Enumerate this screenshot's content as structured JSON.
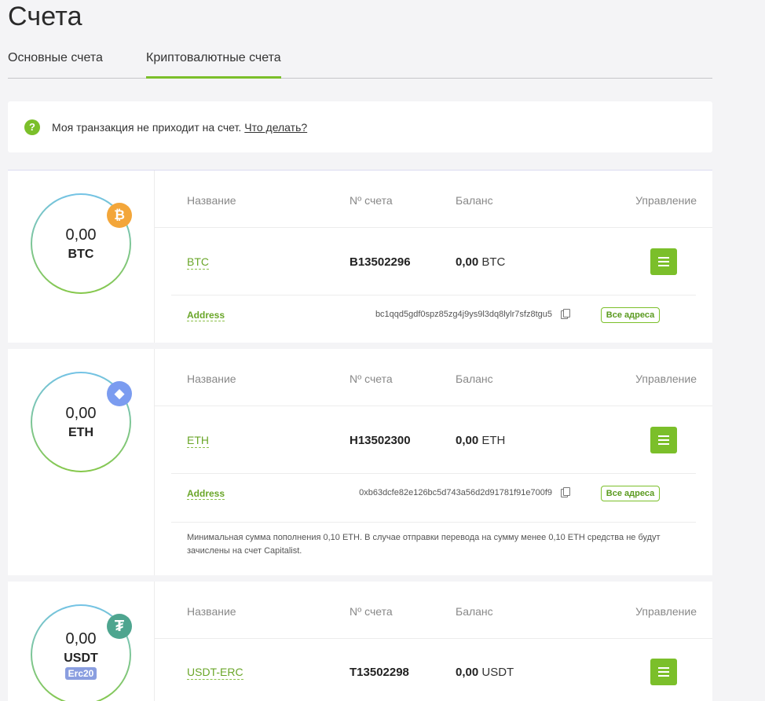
{
  "page": {
    "title": "Счета",
    "tabs": [
      {
        "label": "Основные счета",
        "active": false
      },
      {
        "label": "Криптовалютные счета",
        "active": true
      }
    ]
  },
  "notice": {
    "text": "Моя транзакция не приходит на счет.",
    "link": "Что делать?",
    "icon": "?"
  },
  "table_headers": {
    "name": "Название",
    "account": "Nº счета",
    "balance": "Баланс",
    "management": "Управление"
  },
  "accounts": [
    {
      "ring_amount": "0,00",
      "ring_code": "BTC",
      "coin_icon": "bitcoin-icon",
      "coin_glyph": "₿",
      "name": "BTC",
      "number": "B13502296",
      "balance_amount": "0,00",
      "balance_code": "BTC",
      "address_label": "Address",
      "address": "bc1qqd5gdf0spz85zg4j9ys9l3dq8lylr7sfz8tgu5",
      "all_addresses": "Все адреса"
    },
    {
      "ring_amount": "0,00",
      "ring_code": "ETH",
      "coin_icon": "ethereum-icon",
      "coin_glyph": "◆",
      "name": "ETH",
      "number": "H13502300",
      "balance_amount": "0,00",
      "balance_code": "ETH",
      "address_label": "Address",
      "address": "0xb63dcfe82e126bc5d743a56d2d91781f91e700f9",
      "all_addresses": "Все адреса",
      "note": "Минимальная сумма пополнения 0,10 ETH. В случае отправки перевода на сумму менее 0,10 ETH средства не будут зачислены на счет Capitalist."
    },
    {
      "ring_amount": "0,00",
      "ring_code": "USDT",
      "ring_badge": "Erc20",
      "coin_icon": "tether-icon",
      "coin_glyph": "₮",
      "name": "USDT-ERC",
      "number": "T13502298",
      "balance_amount": "0,00",
      "balance_code": "USDT"
    }
  ],
  "colors": {
    "accent": "#7bbf2a",
    "btc": "#f3a63a",
    "eth": "#7b9cf0",
    "usdt": "#4ea58f"
  }
}
